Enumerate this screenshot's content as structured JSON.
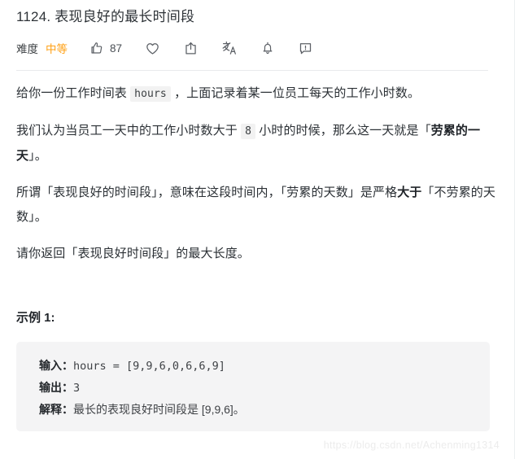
{
  "problem": {
    "title": "1124. 表现良好的最长时间段",
    "difficulty_label": "难度",
    "difficulty_value": "中等",
    "accent_color": "#ffa116"
  },
  "toolbar": {
    "like_count": "87",
    "icons": [
      {
        "name": "thumbs-up-icon",
        "label": "点赞"
      },
      {
        "name": "heart-icon",
        "label": "收藏"
      },
      {
        "name": "share-icon",
        "label": "分享"
      },
      {
        "name": "translate-icon",
        "label": "翻译"
      },
      {
        "name": "bell-icon",
        "label": "订阅"
      },
      {
        "name": "comment-report-icon",
        "label": "反馈"
      }
    ]
  },
  "description": {
    "p1_a": "给你一份工作时间表 ",
    "p1_code": "hours",
    "p1_b": " ，上面记录着某一位员工每天的工作小时数。",
    "p2_a": "我们认为当员工一天中的工作小时数大于 ",
    "p2_code": "8",
    "p2_b": " 小时的时候，那么这一天就是「",
    "p2_bold": "劳累的一天",
    "p2_c": "」。",
    "p3_a": "所谓「表现良好的时间段」，意味在这段时间内，「劳累的天数」是严格",
    "p3_bold": "大于",
    "p3_b": "「不劳累的天数」。",
    "p4": "请你返回「表现良好时间段」的最大长度。"
  },
  "example": {
    "heading": "示例 1:",
    "input_label": "输入：",
    "input_value": "hours = [9,9,6,0,6,6,9]",
    "output_label": "输出：",
    "output_value": "3",
    "explain_label": "解释：",
    "explain_value": "最长的表现良好时间段是 [9,9,6]。"
  },
  "watermark": {
    "text": "https://blog.csdn.net/Achenming1314"
  }
}
